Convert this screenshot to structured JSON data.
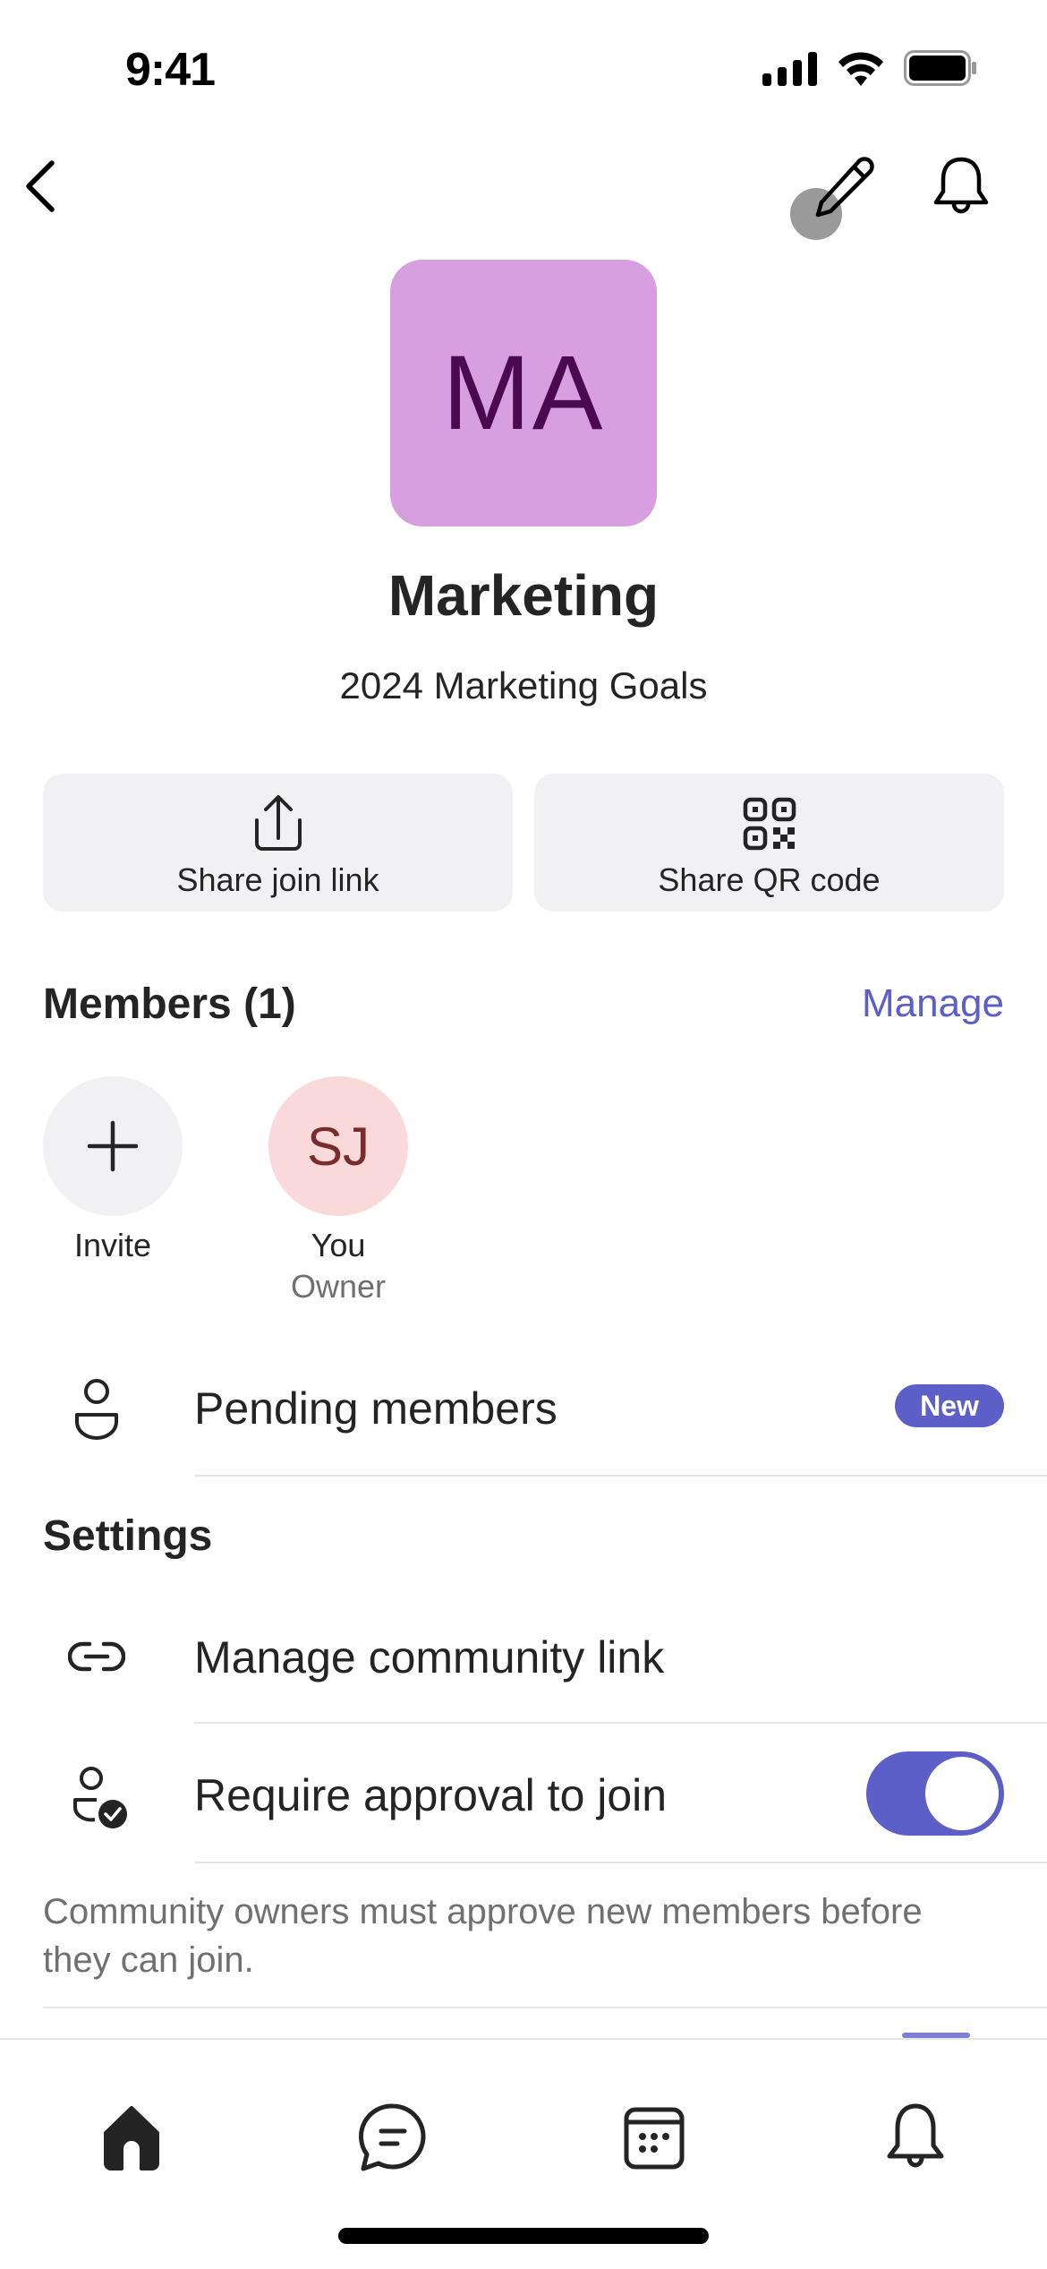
{
  "status_bar": {
    "time": "9:41"
  },
  "nav": {
    "back": "back",
    "edit": "edit",
    "notifications": "notifications"
  },
  "community": {
    "initials": "MA",
    "name": "Marketing",
    "description": "2024 Marketing Goals",
    "avatar_color": "#d89fe0",
    "initials_color": "#4b0a50"
  },
  "share": {
    "join_link_label": "Share join link",
    "qr_code_label": "Share QR code"
  },
  "members": {
    "heading": "Members (1)",
    "manage_label": "Manage",
    "invite_label": "Invite",
    "list": [
      {
        "initials": "SJ",
        "name": "You",
        "role": "Owner"
      }
    ]
  },
  "pending": {
    "label": "Pending members",
    "badge": "New"
  },
  "settings": {
    "heading": "Settings",
    "manage_link_label": "Manage community link",
    "require_approval_label": "Require approval to join",
    "require_approval_on": true,
    "require_approval_help": "Community owners must approve new members before they can join."
  },
  "tabbar": {
    "items": [
      "home",
      "chat",
      "calendar",
      "activity"
    ],
    "active": "home"
  },
  "accent_color": "#5b5fc7"
}
